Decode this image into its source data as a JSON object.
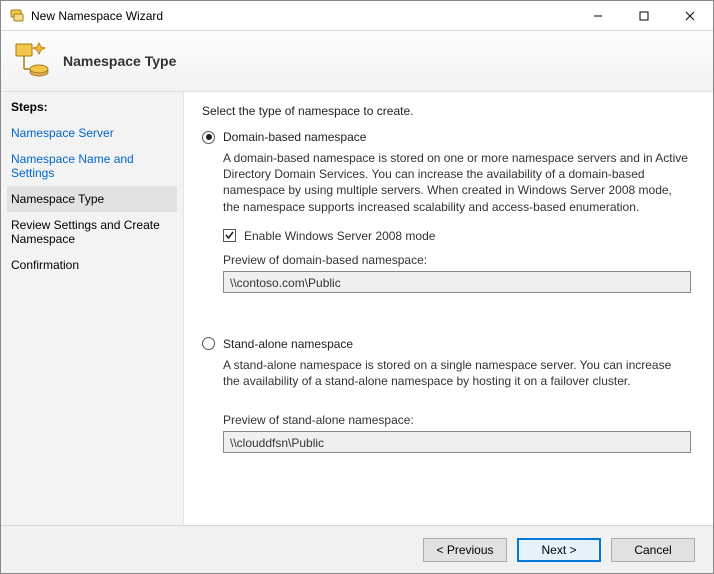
{
  "window": {
    "title": "New Namespace Wizard"
  },
  "header": {
    "heading": "Namespace Type"
  },
  "sidebar": {
    "steps_title": "Steps:",
    "items": [
      {
        "label": "Namespace Server"
      },
      {
        "label": "Namespace Name and Settings"
      },
      {
        "label": "Namespace Type"
      },
      {
        "label": "Review Settings and Create Namespace"
      },
      {
        "label": "Confirmation"
      }
    ],
    "current_index": 2
  },
  "content": {
    "instruction": "Select the type of namespace to create.",
    "domain": {
      "label": "Domain-based namespace",
      "desc": "A domain-based namespace is stored on one or more namespace servers and in Active Directory Domain Services. You can increase the availability of a domain-based namespace by using multiple servers. When created in Windows Server 2008 mode, the namespace supports increased scalability and access-based enumeration.",
      "checkbox_label": "Enable Windows Server 2008 mode",
      "preview_label": "Preview of domain-based namespace:",
      "preview_value": "\\\\contoso.com\\Public"
    },
    "standalone": {
      "label": "Stand-alone namespace",
      "desc": "A stand-alone namespace is stored on a single namespace server. You can increase the availability of a stand-alone namespace by hosting it on a failover cluster.",
      "preview_label": "Preview of stand-alone namespace:",
      "preview_value": "\\\\clouddfsn\\Public"
    }
  },
  "footer": {
    "previous": "< Previous",
    "next": "Next >",
    "cancel": "Cancel"
  }
}
